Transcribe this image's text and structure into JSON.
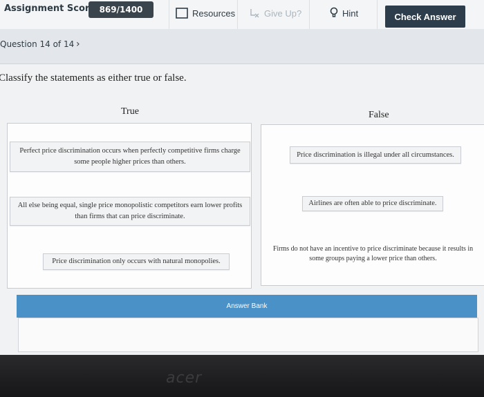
{
  "toolbar": {
    "score_label": "Assignment Score:",
    "score_value": "869/1400",
    "resources_label": "Resources",
    "giveup_label": "Give Up?",
    "hint_label": "Hint",
    "check_label": "Check Answer"
  },
  "question_nav": {
    "label": "Question 14 of 14",
    "chevron": "›"
  },
  "instruction": "Classify the statements as either true or false.",
  "columns": {
    "true_heading": "True",
    "false_heading": "False"
  },
  "cards_true": [
    {
      "text": "Perfect price discrimination occurs when perfectly competitive firms charge some people higher prices than others."
    },
    {
      "text": "All else being equal, single price monopolistic competitors earn lower profits than firms that can price discriminate."
    },
    {
      "text": "Price discrimination only occurs with natural monopolies."
    }
  ],
  "cards_false": [
    {
      "text": "Price discrimination is illegal under all circumstances."
    },
    {
      "text": "Airlines are often able to price discriminate."
    },
    {
      "text": "Firms do not have an incentive to price discriminate because it results in some groups paying a lower price than others."
    }
  ],
  "answer_bank": {
    "label": "Answer Bank"
  },
  "bezel": {
    "logo": "acer"
  }
}
